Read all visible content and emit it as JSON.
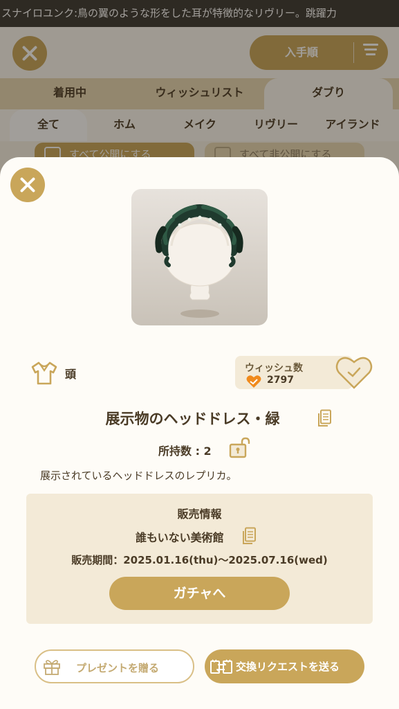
{
  "ticker": {
    "text": "スナイロユンク:鳥の翼のような形をした耳が特徴的なリヴリー。跳躍力"
  },
  "header": {
    "sort_label": "入手順"
  },
  "tabs_primary": [
    {
      "label": "着用中"
    },
    {
      "label": "ウィッシュリスト"
    },
    {
      "label": "ダブり",
      "active": true
    }
  ],
  "tabs_secondary": [
    {
      "label": "全て",
      "active": true
    },
    {
      "label": "ホム"
    },
    {
      "label": "メイク"
    },
    {
      "label": "リヴリー"
    },
    {
      "label": "アイランド"
    }
  ],
  "filters": {
    "public_all": "すべて公開にする",
    "private_all": "すべて非公開にする"
  },
  "item": {
    "category": "頭",
    "category_icon": "shirt-icon",
    "wish_label": "ウィッシュ数",
    "wish_count": "2797",
    "name": "展示物のヘッドドレス・緑",
    "owned": "所持数 : 2",
    "description": "展示されているヘッドドレスのレプリカ。"
  },
  "sales": {
    "title": "販売情報",
    "shop": "誰もいない美術館",
    "period": "販売期間：2025.01.16(thu)〜2025.07.16(wed)",
    "gacha_button": "ガチャへ"
  },
  "actions": {
    "present": "プレゼントを贈る",
    "trade": "交換リクエストを送る"
  },
  "colors": {
    "accent": "#c9a65a",
    "panel": "#f3ead7",
    "text": "#4a3b26",
    "wish_orange": "#f08a1c"
  }
}
